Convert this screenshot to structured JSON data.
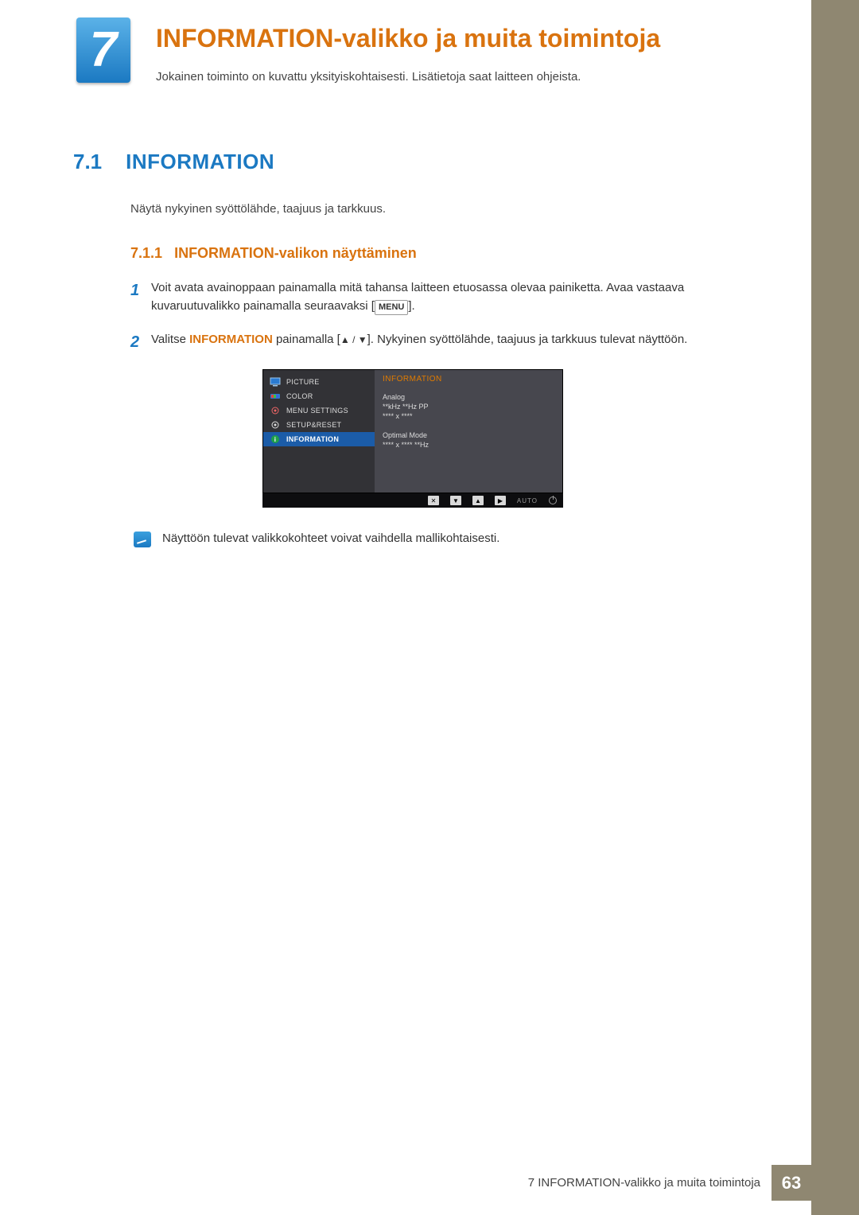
{
  "chapter": {
    "number": "7",
    "title": "INFORMATION-valikko ja muita toimintoja",
    "subtitle": "Jokainen toiminto on kuvattu yksityiskohtaisesti. Lisätietoja saat laitteen ohjeista."
  },
  "section": {
    "number": "7.1",
    "title": "INFORMATION",
    "description": "Näytä nykyinen syöttölähde, taajuus ja tarkkuus."
  },
  "subsection": {
    "number": "7.1.1",
    "title": "INFORMATION-valikon näyttäminen"
  },
  "steps": [
    {
      "num": "1",
      "text_a": "Voit avata avainoppaan painamalla mitä tahansa laitteen etuosassa olevaa painiketta. Avaa vastaava kuvaruutuvalikko painamalla seuraavaksi [",
      "menu": "MENU",
      "text_b": "]."
    },
    {
      "num": "2",
      "text_a": "Valitse ",
      "highlight": "INFORMATION",
      "text_b": " painamalla [",
      "arrows": "▲ / ▼",
      "text_c": "]. Nykyinen syöttölähde, taajuus ja tarkkuus tulevat näyttöön."
    }
  ],
  "osd": {
    "left_items": [
      {
        "label": "PICTURE",
        "icon": "monitor",
        "selected": false
      },
      {
        "label": "COLOR",
        "icon": "palette",
        "selected": false
      },
      {
        "label": "MENU SETTINGS",
        "icon": "target",
        "selected": false
      },
      {
        "label": "SETUP&RESET",
        "icon": "gear",
        "selected": false
      },
      {
        "label": "INFORMATION",
        "icon": "info",
        "selected": true
      }
    ],
    "right": {
      "title": "INFORMATION",
      "lines": [
        "Analog",
        "**kHz **Hz PP",
        "**** x ****",
        "",
        "Optimal Mode",
        "**** x **** **Hz"
      ]
    },
    "bottombar": {
      "buttons": [
        "✕",
        "▼",
        "▲",
        "▶"
      ],
      "auto": "AUTO"
    }
  },
  "note": "Näyttöön tulevat valikkokohteet voivat vaihdella mallikohtaisesti.",
  "footer": {
    "text": "7 INFORMATION-valikko ja muita toimintoja",
    "page": "63"
  }
}
